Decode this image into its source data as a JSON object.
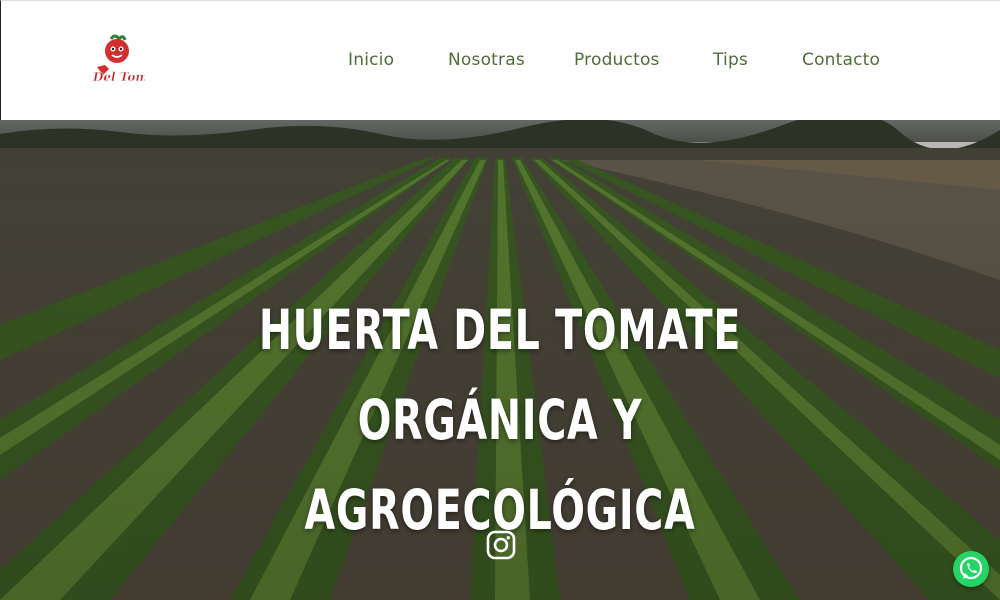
{
  "brand": {
    "logo_text": "Del Tomate",
    "logo_icon": "tomato-mascot-icon",
    "colors": {
      "nav_text": "#4f6d3a",
      "logo_red": "#d32f2f",
      "whatsapp": "#25d366"
    }
  },
  "nav": {
    "items": [
      {
        "label": "Inicio"
      },
      {
        "label": "Nosotras"
      },
      {
        "label": "Productos"
      },
      {
        "label": "Tips"
      },
      {
        "label": "Contacto"
      }
    ]
  },
  "hero": {
    "title": "HUERTA DEL TOMATE ORGÁNICA Y AGROECOLÓGICA",
    "background": "lettuce-field-photo",
    "social_icon": "instagram-icon"
  },
  "floating": {
    "icon": "whatsapp-icon"
  }
}
